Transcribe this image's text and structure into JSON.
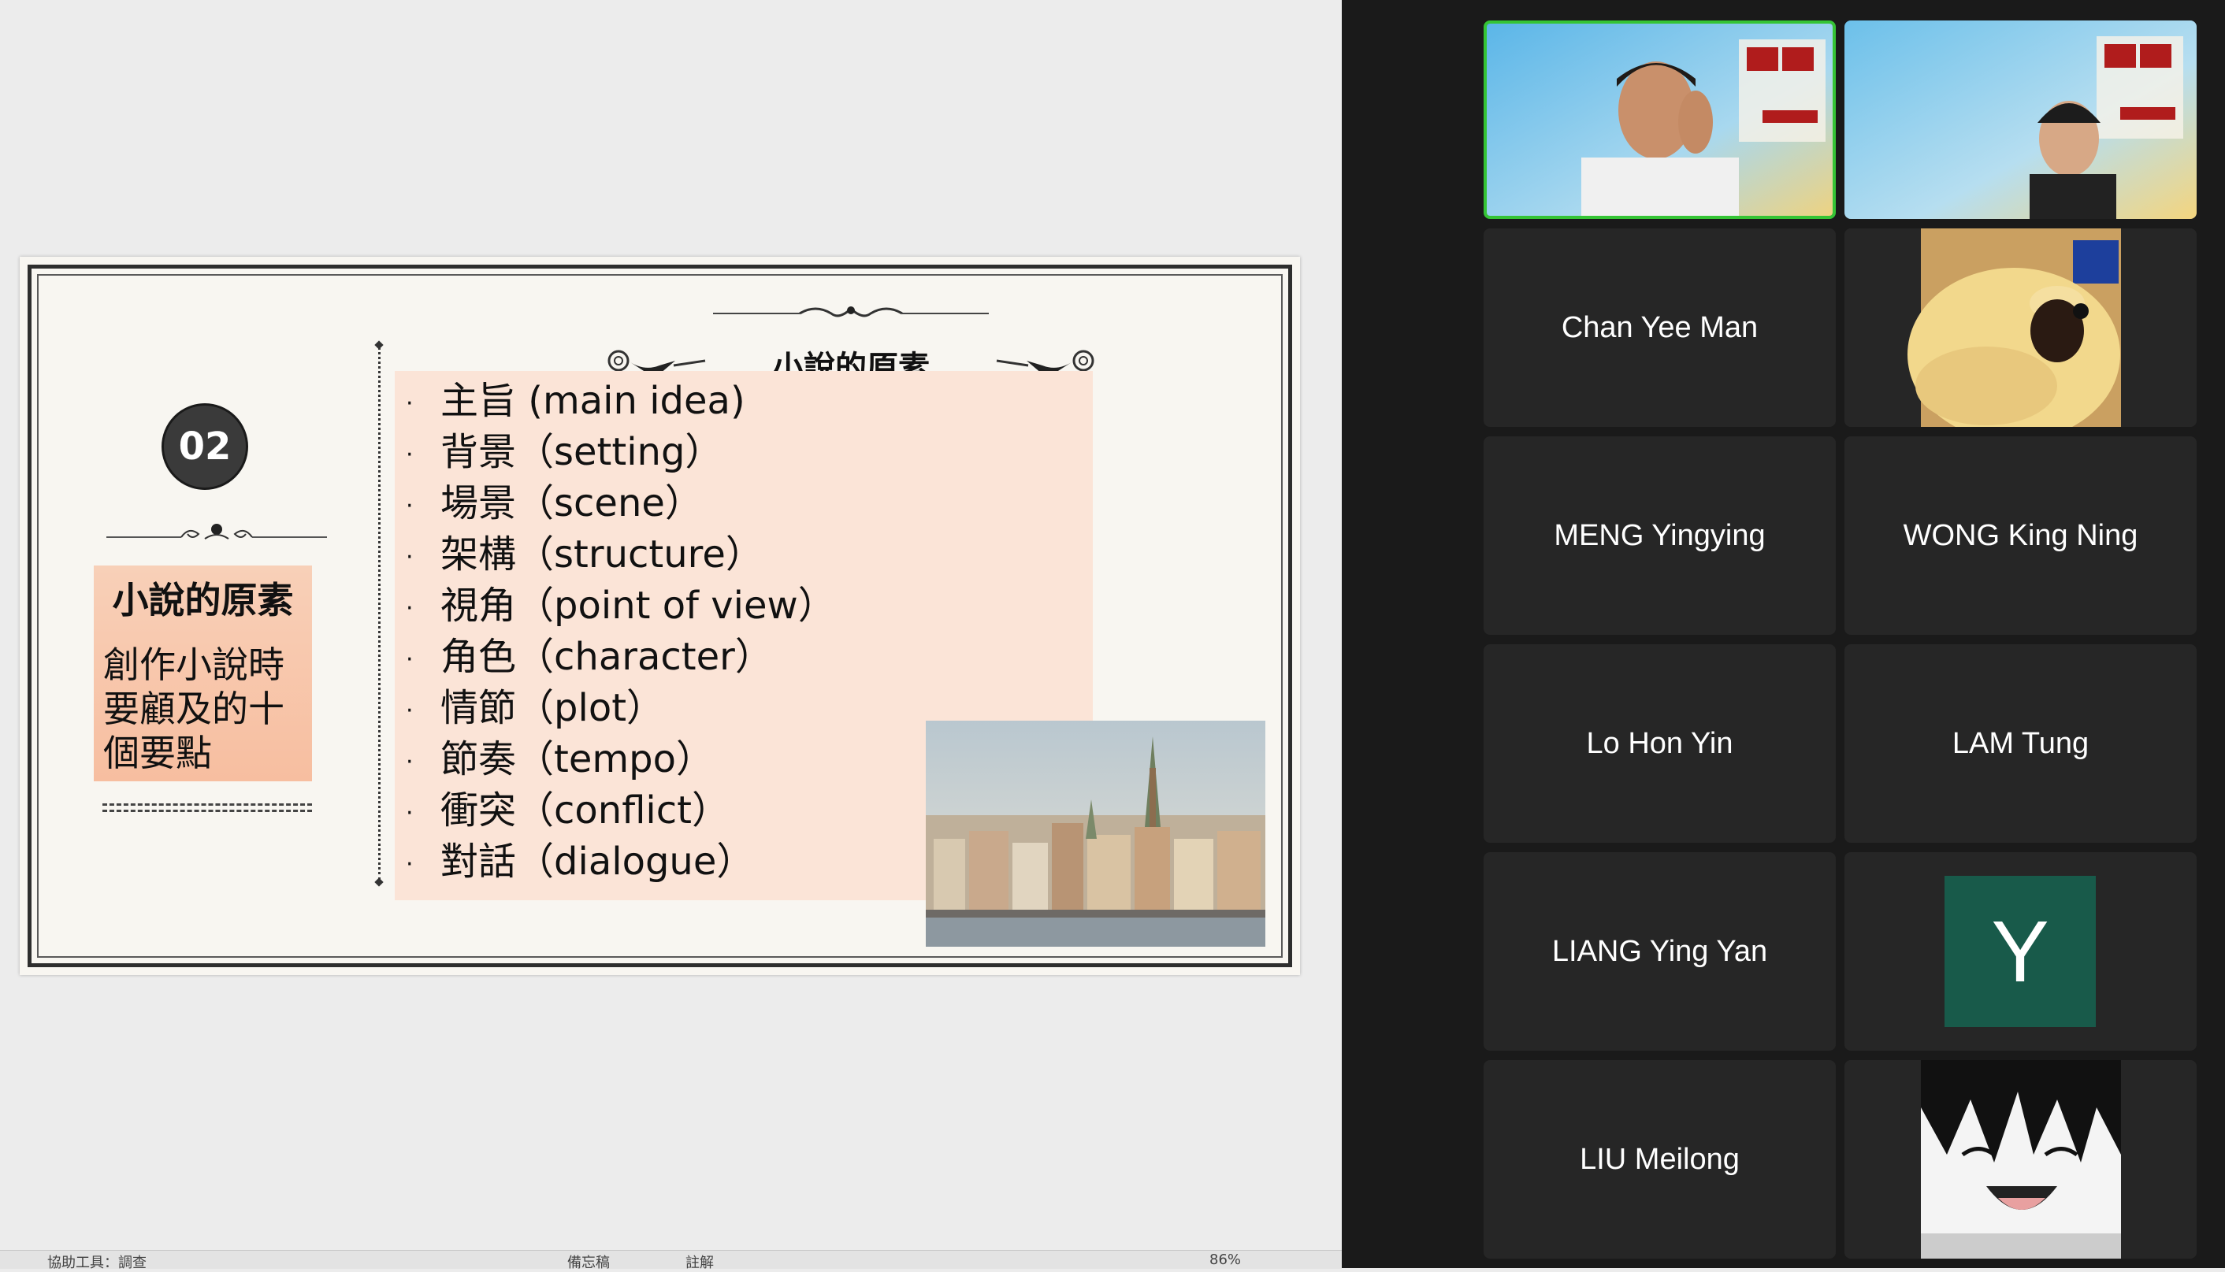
{
  "slide": {
    "section_number": "02",
    "side_title": "小說的原素",
    "side_subtitle": "創作小說時要顧及的十個要點",
    "title": "小說的原素",
    "elements": [
      {
        "zh": "主旨",
        "en": " (main idea)"
      },
      {
        "zh": "背景",
        "en": "（setting）"
      },
      {
        "zh": "場景",
        "en": "（scene）"
      },
      {
        "zh": "架構",
        "en": "（structure）"
      },
      {
        "zh": "視角",
        "en": "（point of view）"
      },
      {
        "zh": "角色",
        "en": "（character）"
      },
      {
        "zh": "情節",
        "en": "（plot）"
      },
      {
        "zh": "節奏",
        "en": "（tempo）"
      },
      {
        "zh": "衝突",
        "en": "（conflict）"
      },
      {
        "zh": "對話",
        "en": "（dialogue）"
      }
    ],
    "bullet": "·"
  },
  "statusbar": {
    "left": "協助工具：調查",
    "notes": "備忘稿",
    "comments": "註解",
    "zoom": "86%"
  },
  "participants": [
    {
      "name": "",
      "type": "video",
      "active": true
    },
    {
      "name": "",
      "type": "video",
      "active": false
    },
    {
      "name": "Chan Yee Man",
      "type": "name"
    },
    {
      "name": "",
      "type": "image-bear"
    },
    {
      "name": "MENG Yingying",
      "type": "name"
    },
    {
      "name": "WONG King Ning",
      "type": "name"
    },
    {
      "name": "Lo Hon Yin",
      "type": "name"
    },
    {
      "name": "LAM Tung",
      "type": "name"
    },
    {
      "name": "LIANG Ying Yan",
      "type": "name"
    },
    {
      "name": "",
      "type": "avatar",
      "initial": "Y"
    },
    {
      "name": "LIU Meilong",
      "type": "name"
    },
    {
      "name": "",
      "type": "image-manga"
    }
  ],
  "colors": {
    "active_border": "#35c435",
    "tile_bg": "#262626",
    "panel_bg": "#1a1a1a",
    "avatar_bg": "#185a4a",
    "slide_box": "#fbe4d7",
    "side_box": "#f9c5a8"
  }
}
